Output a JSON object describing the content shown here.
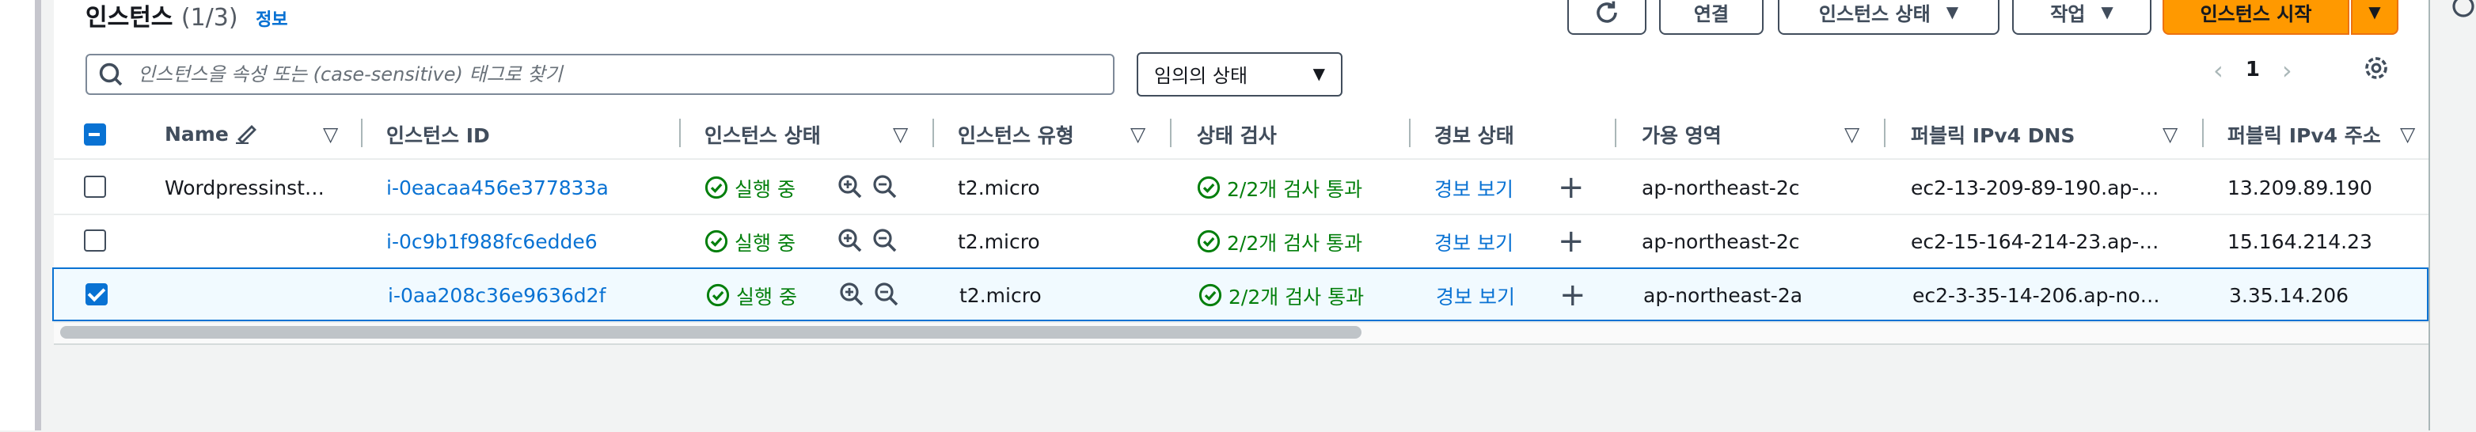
{
  "header": {
    "title": "인스턴스",
    "count": "(1/3)",
    "info_link": "정보",
    "refresh_icon": "refresh-icon",
    "connect_label": "연결",
    "instance_state_label": "인스턴스 상태",
    "actions_label": "작업",
    "launch_label": "인스턴스 시작"
  },
  "filter": {
    "search_placeholder": "인스턴스을 속성 또는 (case-sensitive) 태그로 찾기",
    "search_value": "",
    "state_select_value": "임의의 상태"
  },
  "pagination": {
    "current_page": "1"
  },
  "table": {
    "headers": {
      "name": "Name",
      "instance_id": "인스턴스 ID",
      "instance_state": "인스턴스 상태",
      "instance_type": "인스턴스 유형",
      "status_check": "상태 검사",
      "alarm_status": "경보 상태",
      "availability_zone": "가용 영역",
      "public_dns": "퍼블릭 IPv4 DNS",
      "public_ip": "퍼블릭 IPv4 주소"
    },
    "rows": [
      {
        "selected": false,
        "name": "Wordpressinst…",
        "instance_id": "i-0eacaa456e377833a",
        "state": "실행 중",
        "type": "t2.micro",
        "status_check": "2/2개 검사 통과",
        "alarm": "경보 보기",
        "az": "ap-northeast-2c",
        "dns": "ec2-13-209-89-190.ap-…",
        "ip": "13.209.89.190"
      },
      {
        "selected": false,
        "name": "",
        "instance_id": "i-0c9b1f988fc6edde6",
        "state": "실행 중",
        "type": "t2.micro",
        "status_check": "2/2개 검사 통과",
        "alarm": "경보 보기",
        "az": "ap-northeast-2c",
        "dns": "ec2-15-164-214-23.ap-…",
        "ip": "15.164.214.23"
      },
      {
        "selected": true,
        "name": "",
        "instance_id": "i-0aa208c36e9636d2f",
        "state": "실행 중",
        "type": "t2.micro",
        "status_check": "2/2개 검사 통과",
        "alarm": "경보 보기",
        "az": "ap-northeast-2a",
        "dns": "ec2-3-35-14-206.ap-no…",
        "ip": "3.35.14.206"
      }
    ]
  },
  "colors": {
    "accent": "#0972d3",
    "primary_button": "#ff9900",
    "success": "#037f0c"
  }
}
